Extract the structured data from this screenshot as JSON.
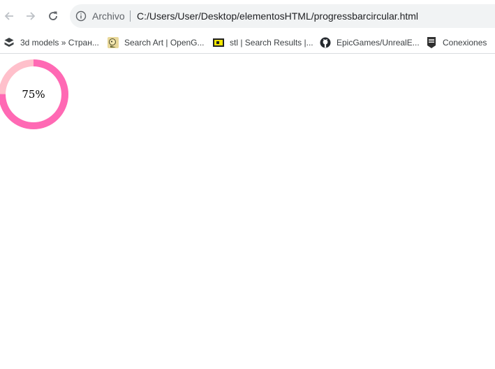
{
  "browser": {
    "nav": {
      "back_icon": "arrow-left-icon",
      "forward_icon": "arrow-right-icon",
      "reload_icon": "reload-icon"
    },
    "address_bar": {
      "info_icon": "info-circle-icon",
      "origin_label": "Archivo",
      "url": "C:/Users/User/Desktop/elementosHTML/progressbarcircular.html"
    },
    "bookmarks": [
      {
        "label": "3d models » Стран...",
        "icon": "box-stack-icon"
      },
      {
        "label": "Search Art | OpenG...",
        "icon": "opengameart-icon"
      },
      {
        "label": "stl | Search Results |...",
        "icon": "yellow-flag-icon"
      },
      {
        "label": "EpicGames/UnrealE...",
        "icon": "github-icon"
      },
      {
        "label": "Conexiones",
        "icon": "epic-games-icon"
      }
    ]
  },
  "page": {
    "progress": {
      "value": 75,
      "label": "75%",
      "fill_color": "#ff69b4",
      "track_color": "#ffc0cb"
    }
  }
}
